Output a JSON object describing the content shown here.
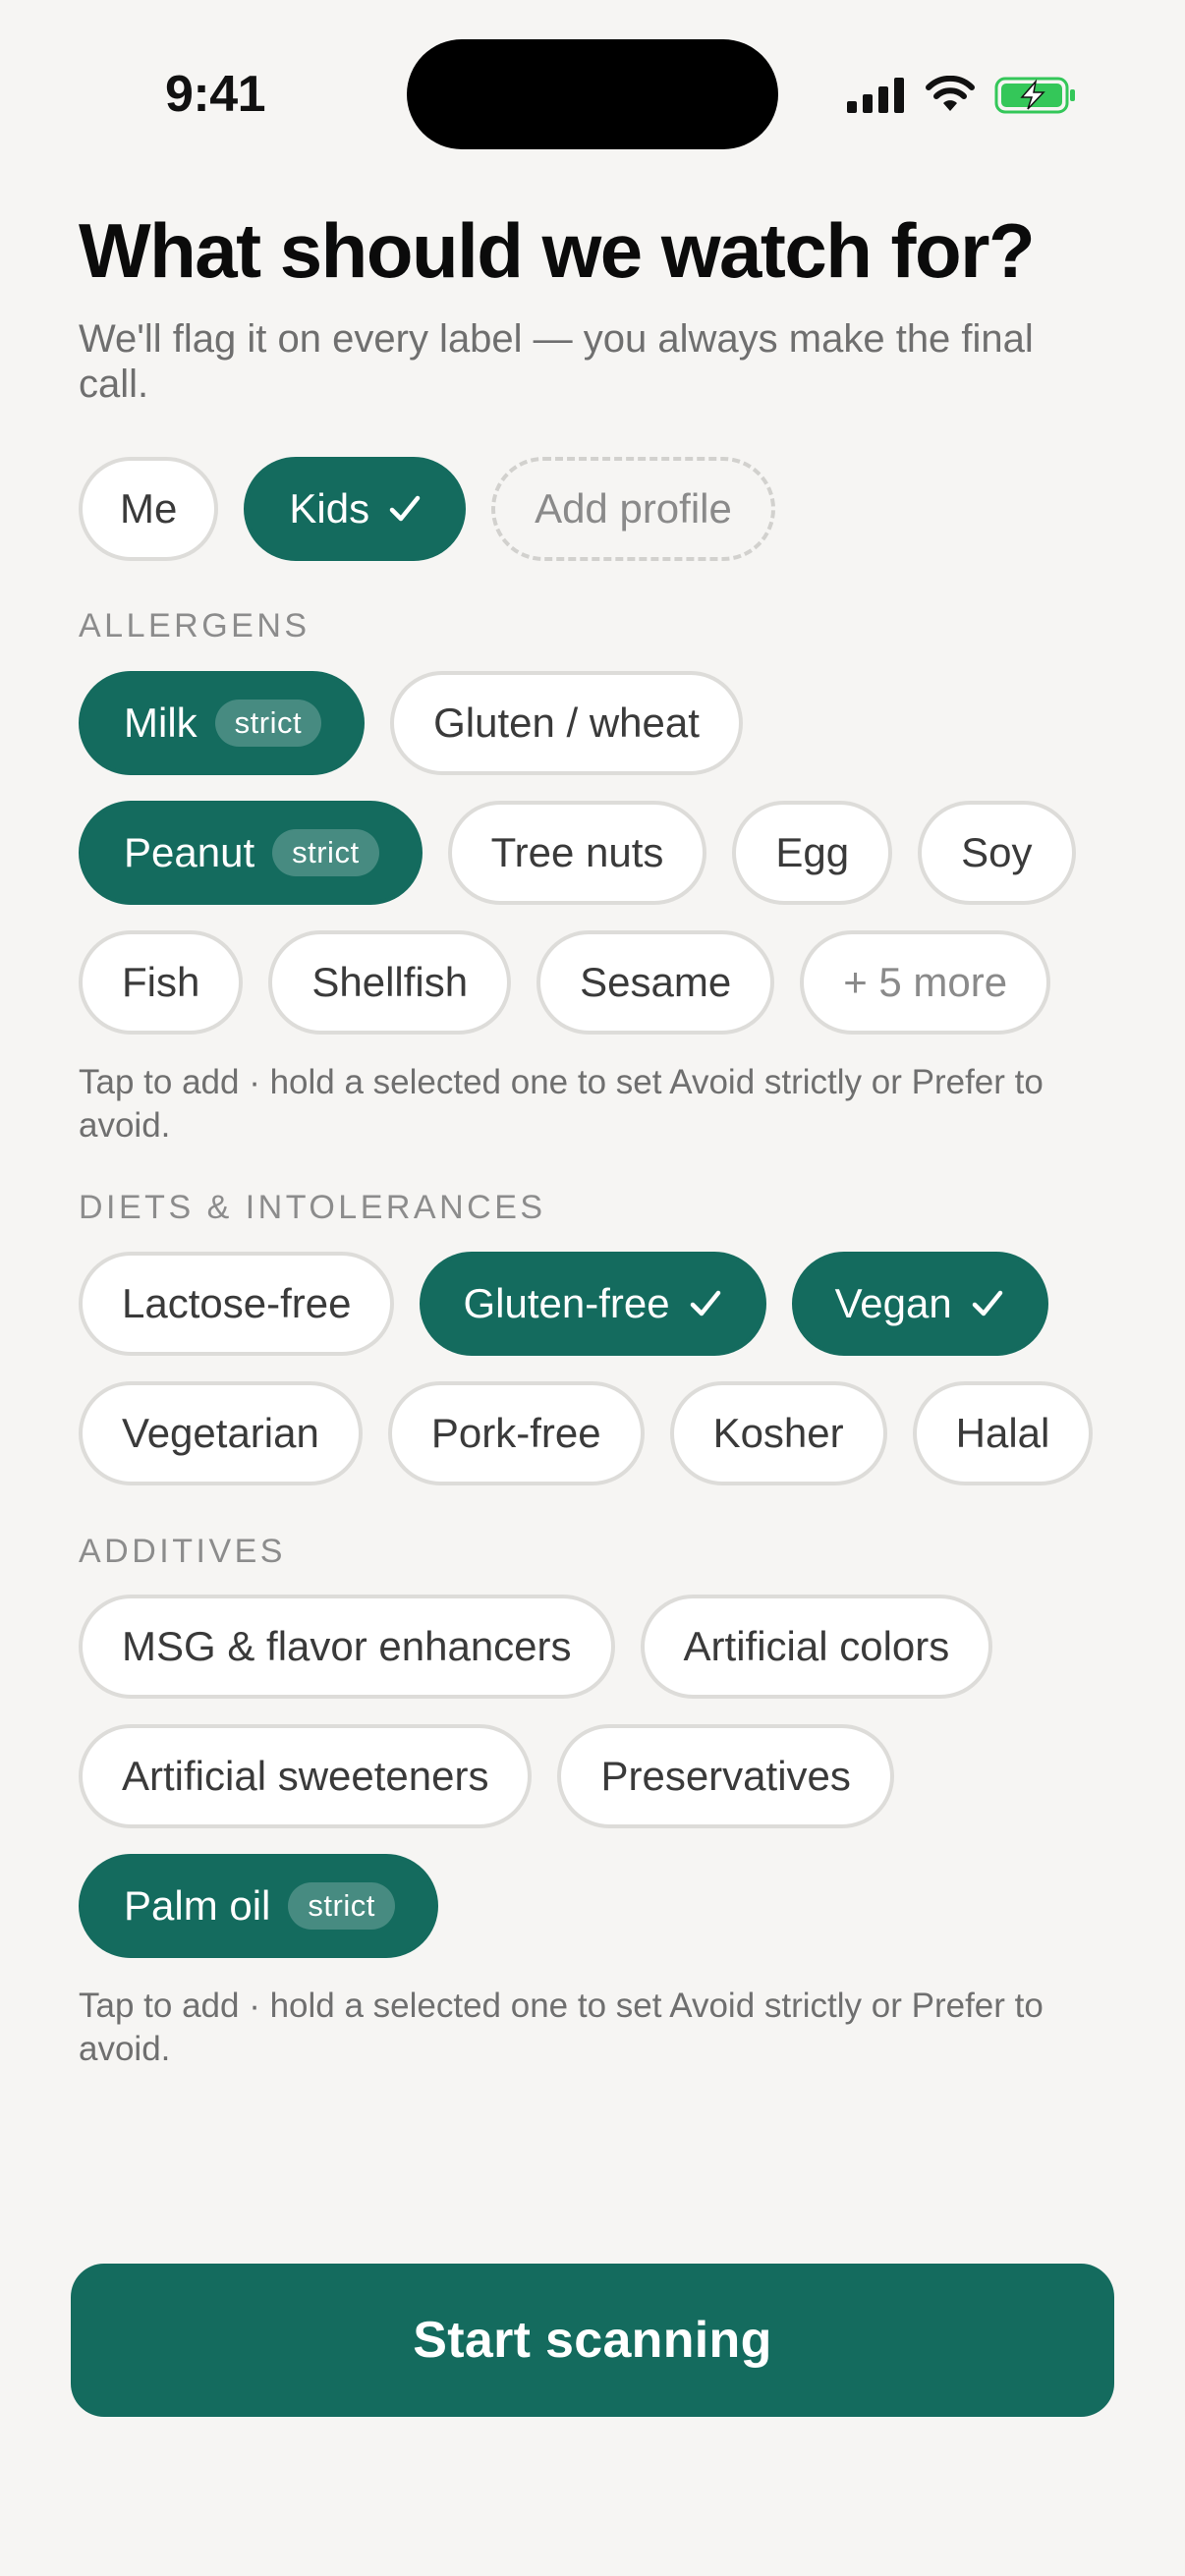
{
  "status_bar": {
    "time": "9:41",
    "icons": [
      "cellular-signal-icon",
      "wifi-icon",
      "battery-charging-icon"
    ]
  },
  "header": {
    "title": "What should we watch for?",
    "subtitle": "We'll flag it on every label — you always make the final call."
  },
  "profiles": {
    "items": [
      {
        "label": "Me",
        "selected": false
      },
      {
        "label": "Kids",
        "selected": true
      },
      {
        "label": "Add profile",
        "selected": false
      }
    ]
  },
  "allergens": {
    "section_label": "ALLERGENS",
    "items": [
      {
        "label": "Milk",
        "selected": true,
        "badge": "strict"
      },
      {
        "label": "Gluten / wheat",
        "selected": false
      },
      {
        "label": "Peanut",
        "selected": true,
        "badge": "strict"
      },
      {
        "label": "Tree nuts",
        "selected": false
      },
      {
        "label": "Egg",
        "selected": false
      },
      {
        "label": "Soy",
        "selected": false
      },
      {
        "label": "Fish",
        "selected": false
      },
      {
        "label": "Shellfish",
        "selected": false
      },
      {
        "label": "Sesame",
        "selected": false
      },
      {
        "label": "+ 5 more",
        "selected": false
      }
    ],
    "hint": "Tap to add · hold a selected one to set Avoid strictly or Prefer to avoid."
  },
  "diets": {
    "section_label": "DIETS & INTOLERANCES",
    "items": [
      {
        "label": "Lactose-free",
        "selected": false
      },
      {
        "label": "Gluten-free",
        "selected": true
      },
      {
        "label": "Vegan",
        "selected": true
      },
      {
        "label": "Vegetarian",
        "selected": false
      },
      {
        "label": "Pork-free",
        "selected": false
      },
      {
        "label": "Kosher",
        "selected": false
      },
      {
        "label": "Halal",
        "selected": false
      }
    ]
  },
  "additives": {
    "section_label": "ADDITIVES",
    "items": [
      {
        "label": "MSG & flavor enhancers",
        "selected": false
      },
      {
        "label": "Artificial colors",
        "selected": false
      },
      {
        "label": "Artificial sweeteners",
        "selected": false
      },
      {
        "label": "Preservatives",
        "selected": false
      },
      {
        "label": "Palm oil",
        "selected": true,
        "badge": "strict"
      }
    ],
    "hint": "Tap to add · hold a selected one to set Avoid strictly or Prefer to avoid."
  },
  "cta": {
    "label": "Start scanning"
  },
  "colors": {
    "accent": "#146B5E",
    "background": "#F6F5F3",
    "chip_border": "#DDDCD9",
    "battery_green": "#34C759"
  }
}
